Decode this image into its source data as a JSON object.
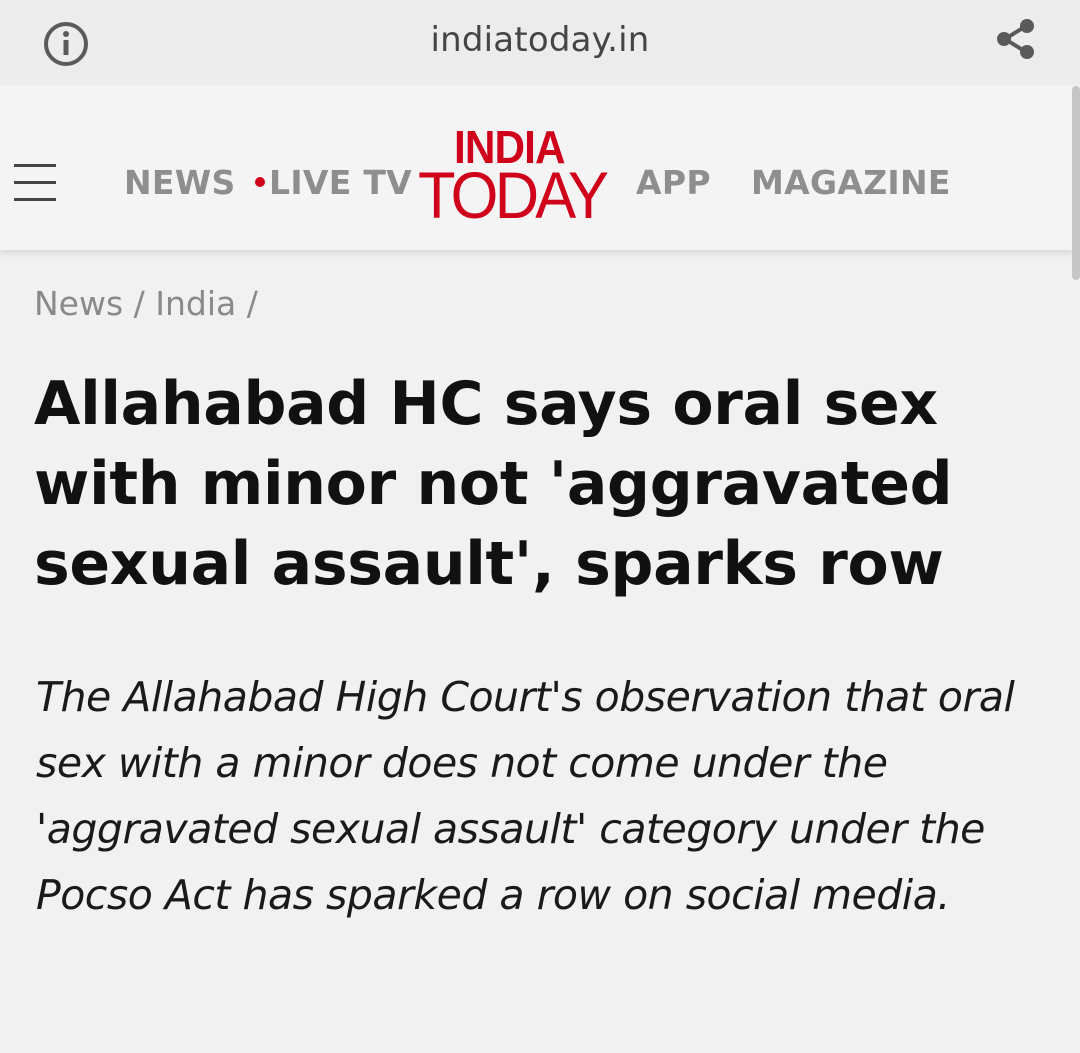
{
  "browser": {
    "url": "indiatoday.in",
    "info_icon": "info-icon",
    "share_icon": "share-icon"
  },
  "header": {
    "menu_icon": "hamburger-menu-icon",
    "nav": {
      "news": "NEWS",
      "live_tv": "LIVE TV",
      "app": "APP",
      "magazine": "MAGAZINE"
    },
    "logo": {
      "line1": "INDIA",
      "line2": "TODAY"
    },
    "colors": {
      "brand_red": "#d0021b",
      "nav_gray": "#8e8e8e"
    }
  },
  "article": {
    "breadcrumb": "News / India /",
    "headline": "Allahabad HC says oral sex with minor not 'aggravated sexual assault', sparks row",
    "summary": "The Allahabad High Court's observation that oral sex with a minor does not come under the 'aggravated sexual assault' category under the Pocso Act has sparked a row on social media."
  }
}
